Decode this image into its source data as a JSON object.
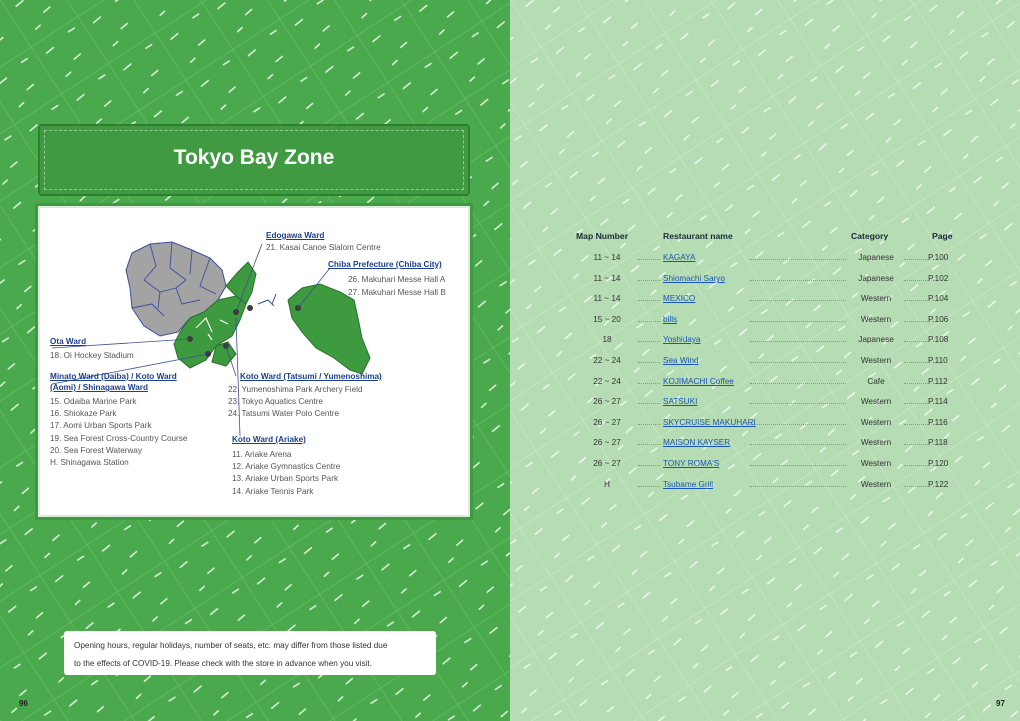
{
  "title": "Tokyo Bay Zone",
  "map": {
    "groups": [
      {
        "heading": "Edogawa Ward",
        "items": [
          "21. Kasai Canoe Slalom Centre"
        ]
      },
      {
        "heading": "Chiba Prefecture (Chiba City)",
        "items": [
          "26. Makuhari Messe Hall A",
          "27. Makuhari Messe Hall B"
        ]
      },
      {
        "heading": "Ota Ward",
        "items": [
          "18. Oi Hockey Stadium"
        ]
      },
      {
        "heading": "Minato Ward (Daiba) / Koto Ward (Aomi) / Shinagawa Ward",
        "heading_lines": [
          "Minato Ward (Daiba) / Koto Ward",
          "(Aomi) / Shinagawa Ward"
        ],
        "items": [
          "15. Odaiba Marine Park",
          "16. Shiokaze Park",
          "17. Aomi Urban Sports Park",
          "19. Sea Forest Cross-Country Course",
          "20. Sea Forest Waterway",
          "H. Shinagawa Station"
        ]
      },
      {
        "heading": "Koto Ward (Tatsumi / Yumenoshima)",
        "items": [
          "22. Yumenoshima Park Archery Field",
          "23. Tokyo Aquatics Centre",
          "24. Tatsumi Water Polo Centre"
        ]
      },
      {
        "heading": "Koto Ward (Ariake)",
        "items": [
          "11. Ariake Arena",
          "12. Ariake Gymnastics Centre",
          "13. Ariake Urban Sports Park",
          "14. Ariake Tennis Park"
        ]
      }
    ]
  },
  "notice": {
    "line1": "Opening hours, regular holidays, number of seats, etc. may differ from those listed due",
    "line2": "to the effects of COVID-19. Please check with the store in advance when you visit."
  },
  "page_left": "96",
  "page_right": "97",
  "table": {
    "headers": {
      "map_number": "Map Number",
      "restaurant": "Restaurant name",
      "category": "Category",
      "page": "Page"
    },
    "rows": [
      {
        "map": "11 ~ 14",
        "name": "KAGAYA",
        "category": "Japanese",
        "page": "P.100"
      },
      {
        "map": "11 ~ 14",
        "name": "Shiomachi Saryo",
        "category": "Japanese",
        "page": "P.102"
      },
      {
        "map": "11 ~ 14",
        "name": "MEXICO",
        "category": "Western",
        "page": "P.104"
      },
      {
        "map": "15 ~ 20",
        "name": "bills",
        "category": "Western",
        "page": "P.106"
      },
      {
        "map": "18",
        "name": "Yoshidaya",
        "category": "Japanese",
        "page": "P.108"
      },
      {
        "map": "22 ~ 24",
        "name": "Sea Wind",
        "category": "Western",
        "page": "P.110"
      },
      {
        "map": "22 ~ 24",
        "name": "KOJIMACHI Coffee",
        "category": "Cafe",
        "page": "P.112"
      },
      {
        "map": "26 ~ 27",
        "name": "SATSUKI",
        "category": "Western",
        "page": "P.114"
      },
      {
        "map": "26 ~ 27",
        "name": "SKYCRUISE MAKUHARI",
        "category": "Western",
        "page": "P.116"
      },
      {
        "map": "26 ~ 27",
        "name": "MAISON KAYSER",
        "category": "Western",
        "page": "P.118"
      },
      {
        "map": "26 ~ 27",
        "name": "TONY ROMA'S",
        "category": "Western",
        "page": "P.120"
      },
      {
        "map": "H",
        "name": "Tsubame Grill",
        "category": "Western",
        "page": "P.122"
      }
    ]
  }
}
